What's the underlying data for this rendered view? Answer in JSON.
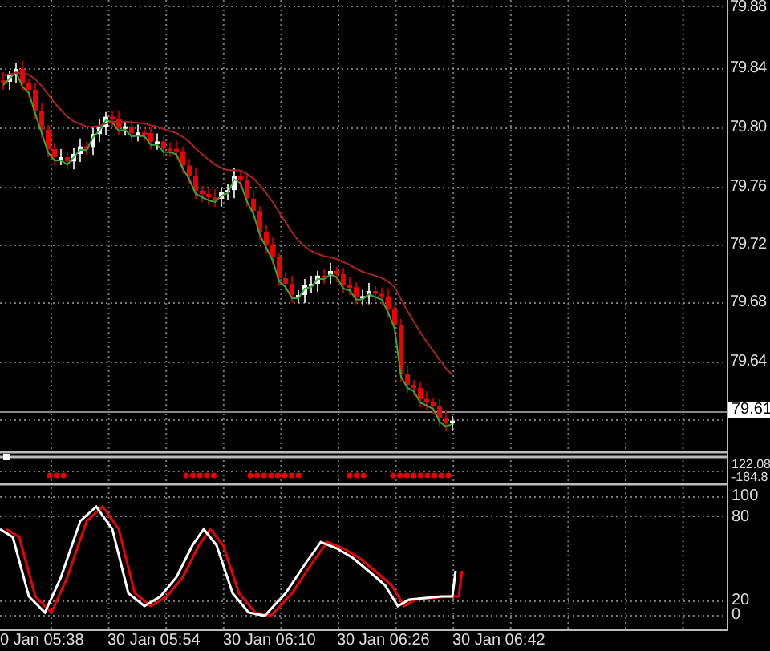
{
  "price_axis": {
    "labels": [
      "79.88",
      "79.84",
      "79.80",
      "79.76",
      "79.72",
      "79.68",
      "79.64"
    ],
    "current_price": "79.61"
  },
  "indicator_axis": {
    "labels": [
      "122.08",
      "-184.8"
    ]
  },
  "stochastic_axis": {
    "labels": [
      "100",
      "80",
      "20",
      "0"
    ]
  },
  "time_axis": {
    "labels": [
      "0 Jan 05:38",
      "30 Jan 05:54",
      "30 Jan 06:10",
      "30 Jan 06:26",
      "30 Jan 06:42"
    ]
  }
}
